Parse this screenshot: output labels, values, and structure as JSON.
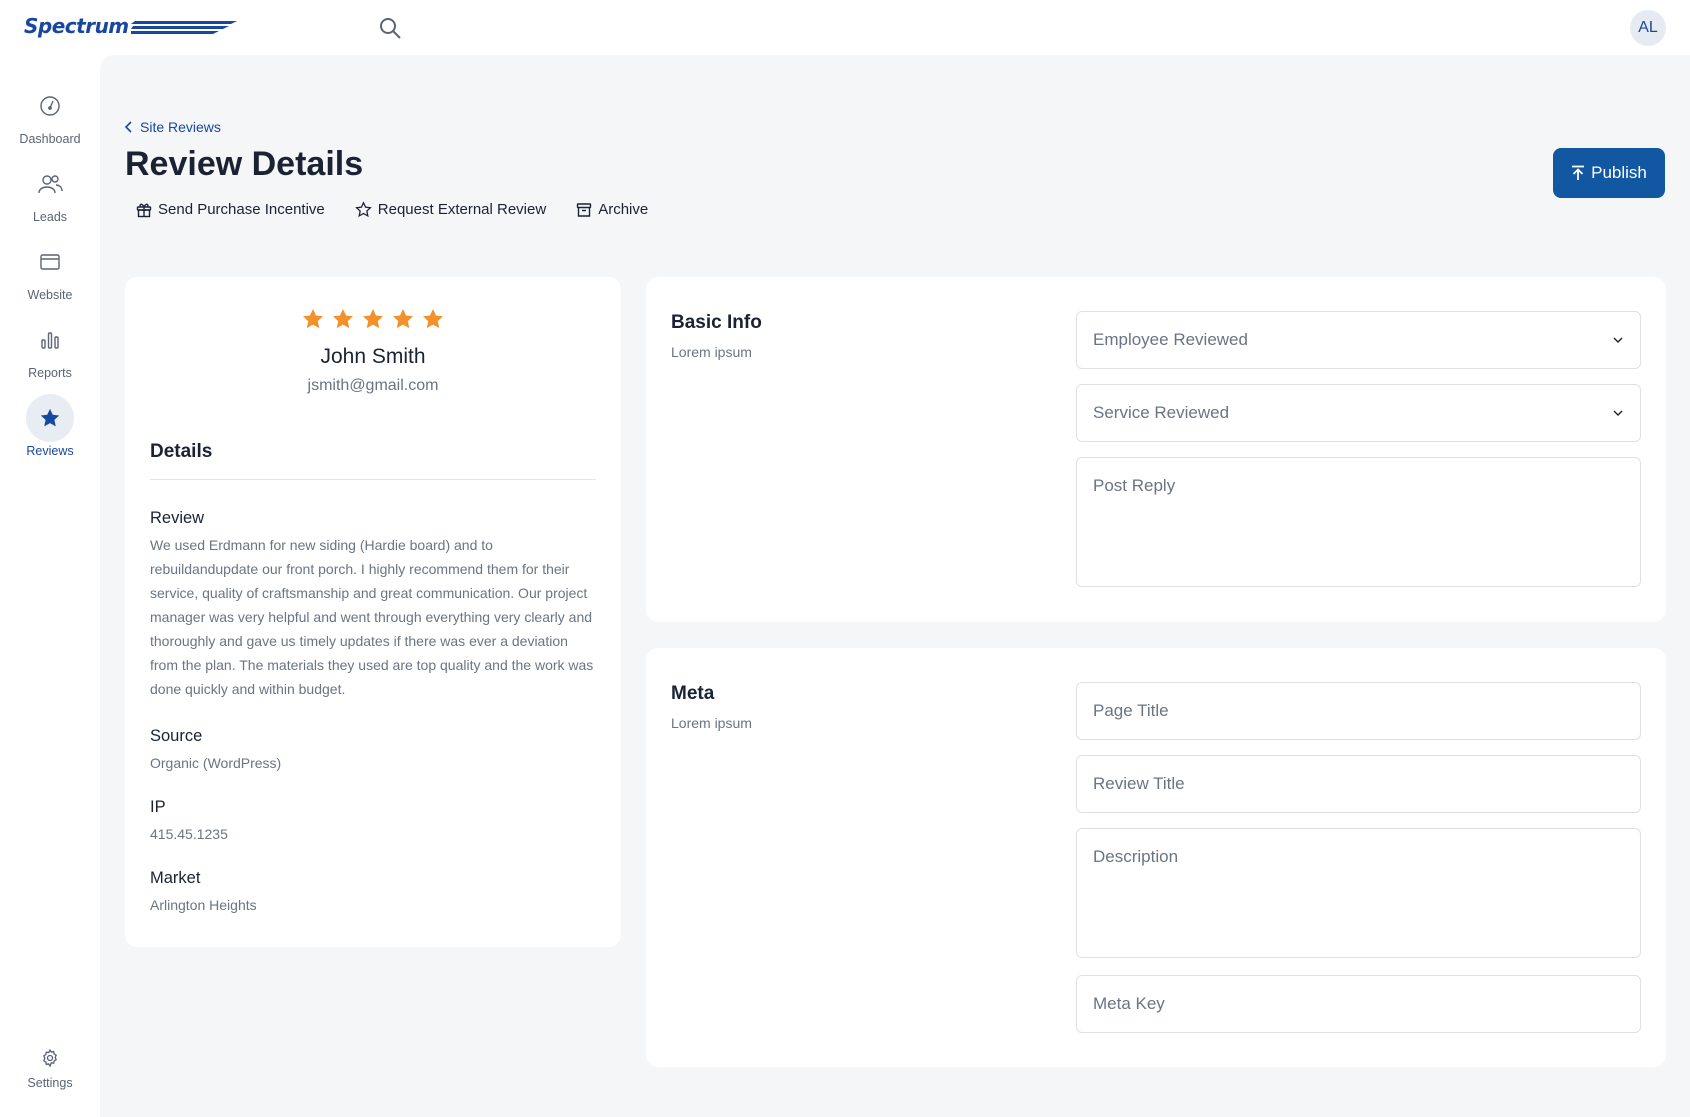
{
  "brand": {
    "name": "Spectrum",
    "color": "#17479e"
  },
  "user": {
    "initials": "AL"
  },
  "sidebar": {
    "items": [
      {
        "label": "Dashboard",
        "icon": "dashboard-gauge-icon"
      },
      {
        "label": "Leads",
        "icon": "users-icon"
      },
      {
        "label": "Website",
        "icon": "browser-window-icon"
      },
      {
        "label": "Reports",
        "icon": "bar-chart-icon"
      },
      {
        "label": "Reviews",
        "icon": "star-icon",
        "active": true
      }
    ],
    "settings_label": "Settings"
  },
  "header": {
    "breadcrumb": "Site Reviews",
    "title": "Review Details",
    "publish_label": "Publish",
    "actions": [
      {
        "label": "Send Purchase Incentive",
        "icon": "gift-icon"
      },
      {
        "label": "Request External Review",
        "icon": "star-outline-icon"
      },
      {
        "label": "Archive",
        "icon": "archive-icon"
      }
    ]
  },
  "review": {
    "rating": 5,
    "name": "John Smith",
    "email": "jsmith@gmail.com",
    "details_title": "Details",
    "review_label": "Review",
    "review_text": "We used Erdmann for new siding (Hardie board) and to rebuildandupdate our front porch. I highly recommend them for their service, quality of craftsmanship and great communication. Our project manager was very helpful and went through everything very clearly and thoroughly and gave us timely updates if there was ever a deviation from the plan. The materials they used are top quality and the work was done quickly and within budget.",
    "source_label": "Source",
    "source_value": "Organic (WordPress)",
    "ip_label": "IP",
    "ip_value": "415.45.1235",
    "market_label": "Market",
    "market_value": "Arlington Heights"
  },
  "basic_info": {
    "title": "Basic Info",
    "subtitle": "Lorem ipsum",
    "employee_placeholder": "Employee Reviewed",
    "service_placeholder": "Service Reviewed",
    "reply_placeholder": "Post Reply"
  },
  "meta": {
    "title": "Meta",
    "subtitle": "Lorem ipsum",
    "page_title_placeholder": "Page Title",
    "review_title_placeholder": "Review Title",
    "description_placeholder": "Description",
    "meta_key_placeholder": "Meta Key"
  },
  "colors": {
    "accent": "#1257a2",
    "star": "#f3922b",
    "background": "#f5f6f8"
  }
}
